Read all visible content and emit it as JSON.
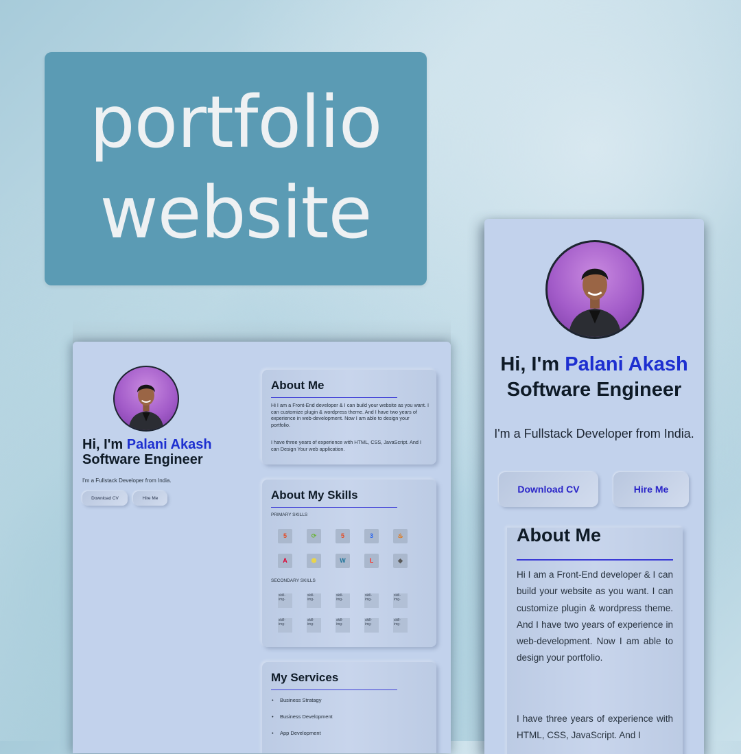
{
  "banner": {
    "line1": "portfolio",
    "line2": "website"
  },
  "hero": {
    "greeting": "Hi, I'm",
    "name": "Palani Akash",
    "role": "Software Engineer",
    "tagline": "I'm a Fullstack Developer from India.",
    "download_cv": "Download CV",
    "hire_me": "Hire Me"
  },
  "about": {
    "title": "About Me",
    "para1": "Hi I am a Front-End developer & I can build your website as you want. I can customize plugin & wordpress theme. And I have two years of experience in web-development. Now I am able to design your portfolio.",
    "para2": "I have three years of experience with HTML, CSS, JavaScript. And I can Design Your web application.",
    "para2_mobile": "I have three years of experience with HTML, CSS, JavaScript. And I"
  },
  "skills": {
    "title": "About My Skills",
    "primary_label": "PRIMARY SKILLS",
    "secondary_label": "SECONDARY SKILLS",
    "primary": [
      {
        "icon": "html5-icon",
        "glyph": "5",
        "color": "#e44d26"
      },
      {
        "icon": "spring-icon",
        "glyph": "⟳",
        "color": "#6db33f"
      },
      {
        "icon": "html5-icon",
        "glyph": "5",
        "color": "#e44d26"
      },
      {
        "icon": "css3-icon",
        "glyph": "3",
        "color": "#2965f1"
      },
      {
        "icon": "java-icon",
        "glyph": "♨",
        "color": "#e76f00"
      },
      {
        "icon": "angular-icon",
        "glyph": "A",
        "color": "#dd0031"
      },
      {
        "icon": "nodejs-icon",
        "glyph": "⬢",
        "color": "#e8d44d"
      },
      {
        "icon": "wordpress-icon",
        "glyph": "W",
        "color": "#21759b"
      },
      {
        "icon": "laravel-icon",
        "glyph": "L",
        "color": "#ff2d20"
      },
      {
        "icon": "layers-icon",
        "glyph": "◆",
        "color": "#5a5a5a"
      }
    ],
    "secondary_alt": "skill-img-"
  },
  "services": {
    "title": "My Services",
    "items": [
      "Business Stratagy",
      "Business Development",
      "App Development"
    ]
  },
  "colors": {
    "accent": "#1d2fd0",
    "button_text": "#2a25c8",
    "page_bg": "#c2d2ec",
    "banner_bg": "#5b9bb4"
  }
}
